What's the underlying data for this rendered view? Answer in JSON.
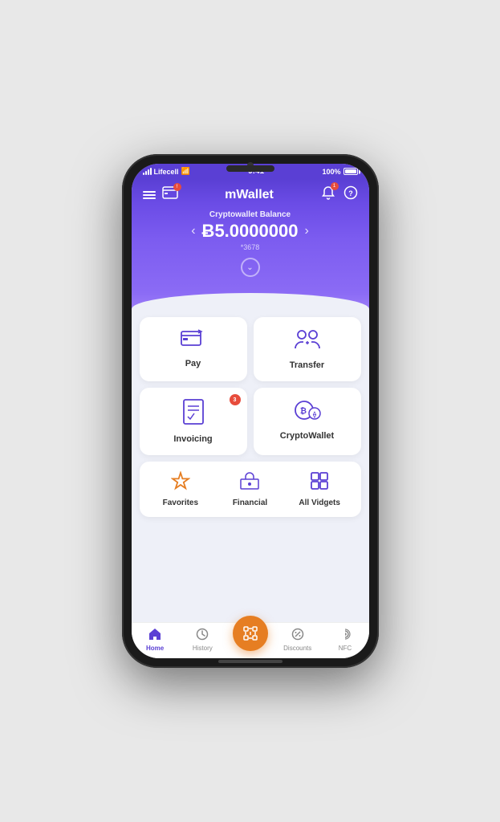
{
  "status_bar": {
    "carrier": "Lifecell",
    "time": "9:41",
    "battery": "100%"
  },
  "header": {
    "title": "mWallet",
    "menu_label": "menu",
    "card_label": "card",
    "bell_label": "notifications",
    "help_label": "help"
  },
  "balance": {
    "label": "Cryptowallet Balance",
    "currency_symbol": "Ƀ",
    "amount": "5.0000000",
    "account": "*3678",
    "expand_label": "expand"
  },
  "grid_cards": [
    {
      "id": "pay",
      "label": "Pay",
      "badge": null
    },
    {
      "id": "transfer",
      "label": "Transfer",
      "badge": null
    },
    {
      "id": "invoicing",
      "label": "Invoicing",
      "badge": "3"
    },
    {
      "id": "cryptowallet",
      "label": "CryptoWallet",
      "badge": null
    }
  ],
  "bottom_row": [
    {
      "id": "favorites",
      "label": "Favorites",
      "color": "orange"
    },
    {
      "id": "financial",
      "label": "Financial",
      "color": "purple"
    },
    {
      "id": "allvidgets",
      "label": "All Vidgets",
      "color": "purple"
    }
  ],
  "nav": {
    "items": [
      {
        "id": "home",
        "label": "Home",
        "active": true
      },
      {
        "id": "history",
        "label": "History",
        "active": false
      },
      {
        "id": "scan",
        "label": "Scan",
        "active": false,
        "center": true
      },
      {
        "id": "discounts",
        "label": "Discounts",
        "active": false
      },
      {
        "id": "nfc",
        "label": "NFC",
        "active": false
      }
    ]
  }
}
